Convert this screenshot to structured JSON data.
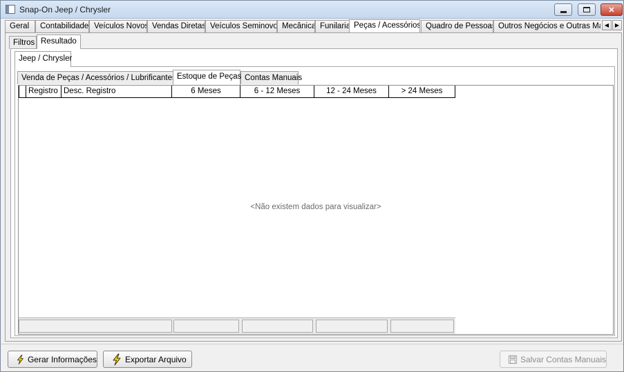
{
  "window": {
    "title": "Snap-On Jeep / Chrysler"
  },
  "main_tabs": [
    "Geral",
    "Contabilidade",
    "Veículos Novos",
    "Vendas Diretas",
    "Veículos Seminovos",
    "Mecânica",
    "Funilaria",
    "Peças / Acessórios",
    "Quadro de Pessoas",
    "Outros Negócios e Outras Marcas"
  ],
  "active_main_tab": "Peças / Acessórios",
  "view_tabs": [
    "Filtros",
    "Resultado"
  ],
  "active_view_tab": "Resultado",
  "brand_tab": "Jeep / Chrysler",
  "section_tabs": [
    "Venda de Peças / Acessórios / Lubrificantes",
    "Estoque de Peças",
    "Contas Manuais"
  ],
  "active_section_tab": "Estoque de Peças",
  "grid": {
    "columns": [
      "Registro",
      "Desc. Registro",
      "6 Meses",
      "6 - 12 Meses",
      "12 - 24 Meses",
      "> 24 Meses"
    ],
    "empty_message": "<Não existem dados para visualizar>"
  },
  "buttons": {
    "generate": "Gerar Informações",
    "export": "Exportar Arquivo",
    "save_manual": "Salvar Contas Manuais"
  },
  "icons": {
    "generate": "lightning-bolt-icon",
    "export": "lightning-bolt-icon",
    "save_manual": "save-icon"
  },
  "colors": {
    "bolt_fill": "#f3d417",
    "bolt_stroke": "#3a3000"
  }
}
